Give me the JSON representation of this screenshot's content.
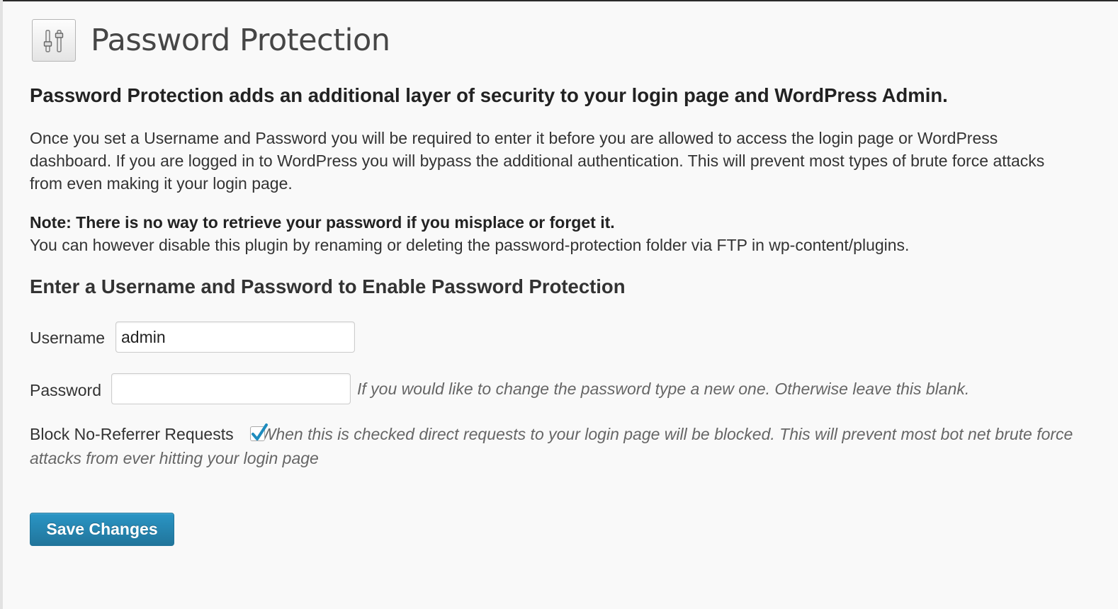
{
  "header": {
    "icon": "plugin-settings-icon",
    "title": "Password Protection"
  },
  "intro": {
    "heading": "Password Protection adds an additional layer of security to your login page and WordPress Admin.",
    "text": "Once you set a Username and Password you will be required to enter it before you are allowed to access the login page or WordPress dashboard. If you are logged in to WordPress you will bypass the additional authentication. This will prevent most types of brute force attacks from even making it your login page."
  },
  "note": {
    "bold": "Note: There is no way to retrieve your password if you misplace or forget it.",
    "text": "You can however disable this plugin by renaming or deleting the password-protection folder via FTP in wp-content/plugins."
  },
  "form": {
    "heading": "Enter a Username and Password to Enable Password Protection",
    "username": {
      "label": "Username",
      "value": "admin"
    },
    "password": {
      "label": "Password",
      "value": "",
      "hint": "If you would like to change the password type a new one. Otherwise leave this blank."
    },
    "block_no_referrer": {
      "label": "Block No-Referrer Requests",
      "checked": true,
      "description": "When this is checked direct requests to your login page will be blocked. This will prevent most bot net brute force attacks from ever hitting your login page"
    },
    "save_label": "Save Changes"
  },
  "colors": {
    "button": "#21759b",
    "checkmark": "#1e8cbe",
    "background": "#f9f9f9"
  }
}
